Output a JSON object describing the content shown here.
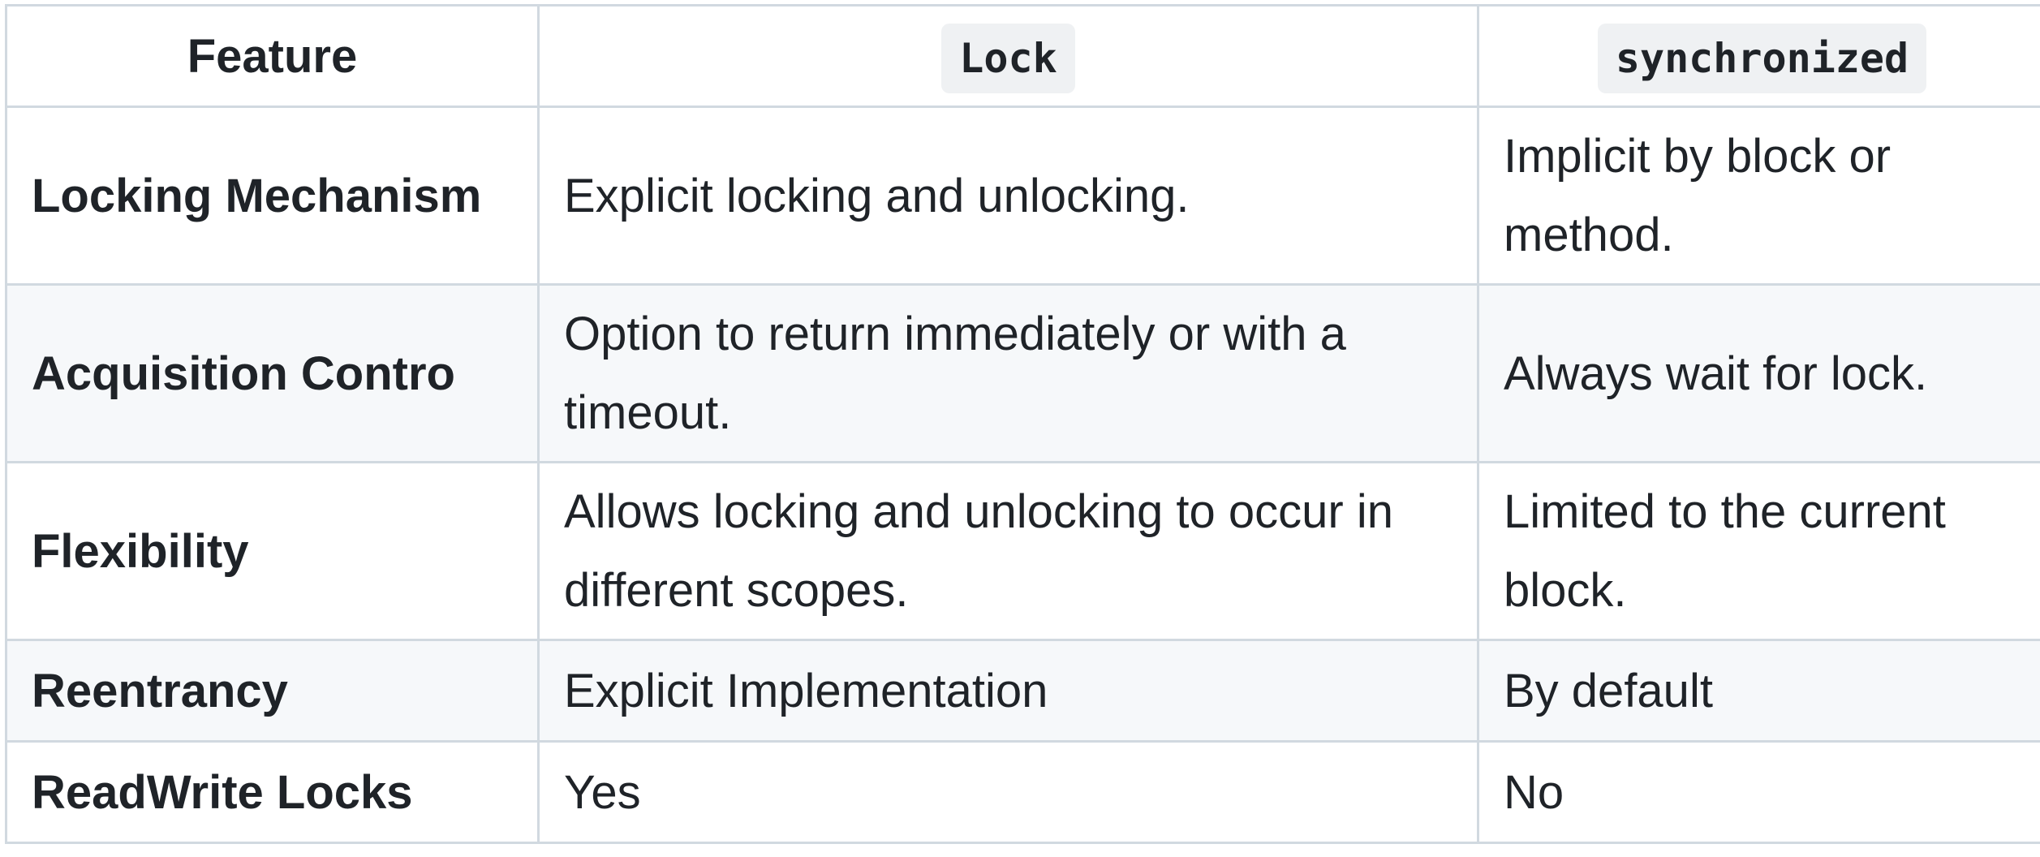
{
  "table": {
    "headers": {
      "feature": "Feature",
      "lock": "Lock",
      "synchronized": "synchronized"
    },
    "rows": [
      {
        "feature": "Locking Mechanism",
        "lock": "Explicit locking and unlocking.",
        "synchronized": "Implicit by block or method."
      },
      {
        "feature": "Acquisition Contro",
        "lock": "Option to return immediately or with a timeout.",
        "synchronized": "Always wait for lock."
      },
      {
        "feature": "Flexibility",
        "lock": "Allows locking and unlocking to occur in different scopes.",
        "synchronized": "Limited to the current block."
      },
      {
        "feature": "Reentrancy",
        "lock": "Explicit Implementation",
        "synchronized": "By default"
      },
      {
        "feature": "ReadWrite Locks",
        "lock": "Yes",
        "synchronized": "No"
      }
    ]
  }
}
